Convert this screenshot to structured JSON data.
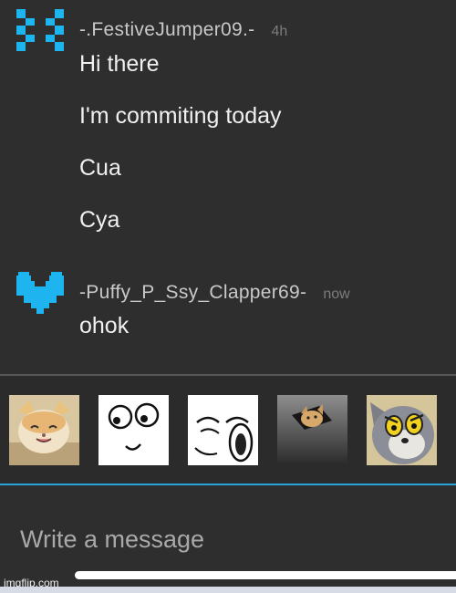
{
  "messages": [
    {
      "username": "-.FestiveJumper09.-",
      "timestamp": "4h",
      "avatar_icon": "pixel-x-avatar-icon",
      "lines": [
        "Hi there",
        "I'm commiting today",
        "Cua",
        "Cya"
      ]
    },
    {
      "username": "-Puffy_P_Ssy_Clapper69-",
      "timestamp": "now",
      "avatar_icon": "pixel-heart-avatar-icon",
      "lines": [
        "ohok"
      ]
    }
  ],
  "stickers": [
    {
      "icon": "smiling-cat-sticker"
    },
    {
      "icon": "derp-rage-face-sticker"
    },
    {
      "icon": "lol-rage-face-sticker"
    },
    {
      "icon": "ceiling-cat-sticker"
    },
    {
      "icon": "shocked-tom-cat-sticker"
    }
  ],
  "composer": {
    "placeholder": "Write a message"
  },
  "watermark": "imgflip.com",
  "colors": {
    "background": "#2e2e2e",
    "accent": "#27a5d8",
    "avatar": "#1eb4f0",
    "divider": "#575757"
  }
}
